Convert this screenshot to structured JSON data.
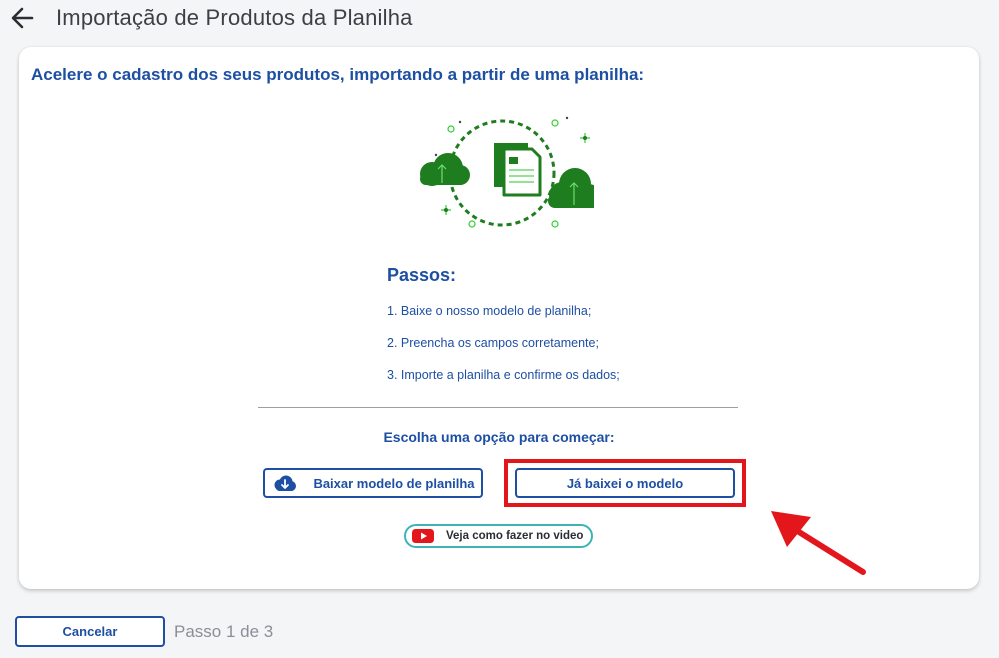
{
  "header": {
    "title": "Importação de Produtos da Planilha",
    "back_icon": "arrow-left-icon"
  },
  "card": {
    "heading": "Acelere o cadastro dos seus produtos, importando a partir de uma planilha:",
    "illustration_icon": "spreadsheet-cloud-upload-illustration",
    "steps_title": "Passos:",
    "steps": [
      "1. Baixe o nosso modelo de planilha;",
      "2. Preencha os campos corretamente;",
      "3. Importe a planilha e confirme os dados;"
    ],
    "choose_label": "Escolha uma opção para começar:",
    "download_button": {
      "label": "Baixar modelo de planilha",
      "icon": "cloud-download-icon"
    },
    "already_button": {
      "label": "Já baixei o modelo"
    },
    "video_button": {
      "label": "Veja como fazer no video",
      "icon": "youtube-icon"
    }
  },
  "footer": {
    "cancel_label": "Cancelar",
    "step_indicator": "Passo 1 de 3"
  },
  "colors": {
    "primary": "#1d4fa3",
    "illustration_green": "#1e7d1e",
    "highlight_red": "#e3161b",
    "video_border": "#3cb4b4"
  }
}
